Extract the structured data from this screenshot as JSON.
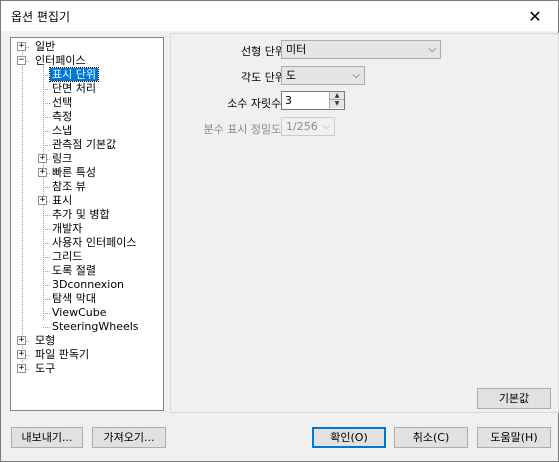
{
  "window": {
    "title": "옵션 편집기",
    "close_glyph": "✕"
  },
  "tree": {
    "items": [
      {
        "label": "일반",
        "expander": "+"
      },
      {
        "label": "인터페이스",
        "expander": "−"
      },
      {
        "label": "표시 단위"
      },
      {
        "label": "단면 처리"
      },
      {
        "label": "선택"
      },
      {
        "label": "측정"
      },
      {
        "label": "스냅"
      },
      {
        "label": "관측점 기본값"
      },
      {
        "label": "링크",
        "expander": "+"
      },
      {
        "label": "빠른 특성",
        "expander": "+"
      },
      {
        "label": "참조 뷰"
      },
      {
        "label": "표시",
        "expander": "+"
      },
      {
        "label": "추가 및 병합"
      },
      {
        "label": "개발자"
      },
      {
        "label": "사용자 인터페이스"
      },
      {
        "label": "그리드"
      },
      {
        "label": "도록 절렬"
      },
      {
        "label": "3Dconnexion"
      },
      {
        "label": "탐색 막대"
      },
      {
        "label": "ViewCube"
      },
      {
        "label": "SteeringWheels"
      },
      {
        "label": "모형",
        "expander": "+"
      },
      {
        "label": "파일 판독기",
        "expander": "+"
      },
      {
        "label": "도구",
        "expander": "+"
      }
    ]
  },
  "panel": {
    "linear_units": {
      "label": "선형 단위",
      "value": "미터"
    },
    "angular_units": {
      "label": "각도 단위",
      "value": "도"
    },
    "decimal_places": {
      "label": "소수 자릿수:",
      "value": "3"
    },
    "fraction_precision": {
      "label": "분수 표시 정밀도:",
      "value": "1/256"
    },
    "defaults_button": "기본값"
  },
  "footer": {
    "export": "내보내기...",
    "import": "가져오기...",
    "ok": "확인(O)",
    "cancel": "취소(C)",
    "help": "도움말(H)"
  },
  "colors": {
    "selection": "#0078d7",
    "accent_border": "#0078d7"
  }
}
